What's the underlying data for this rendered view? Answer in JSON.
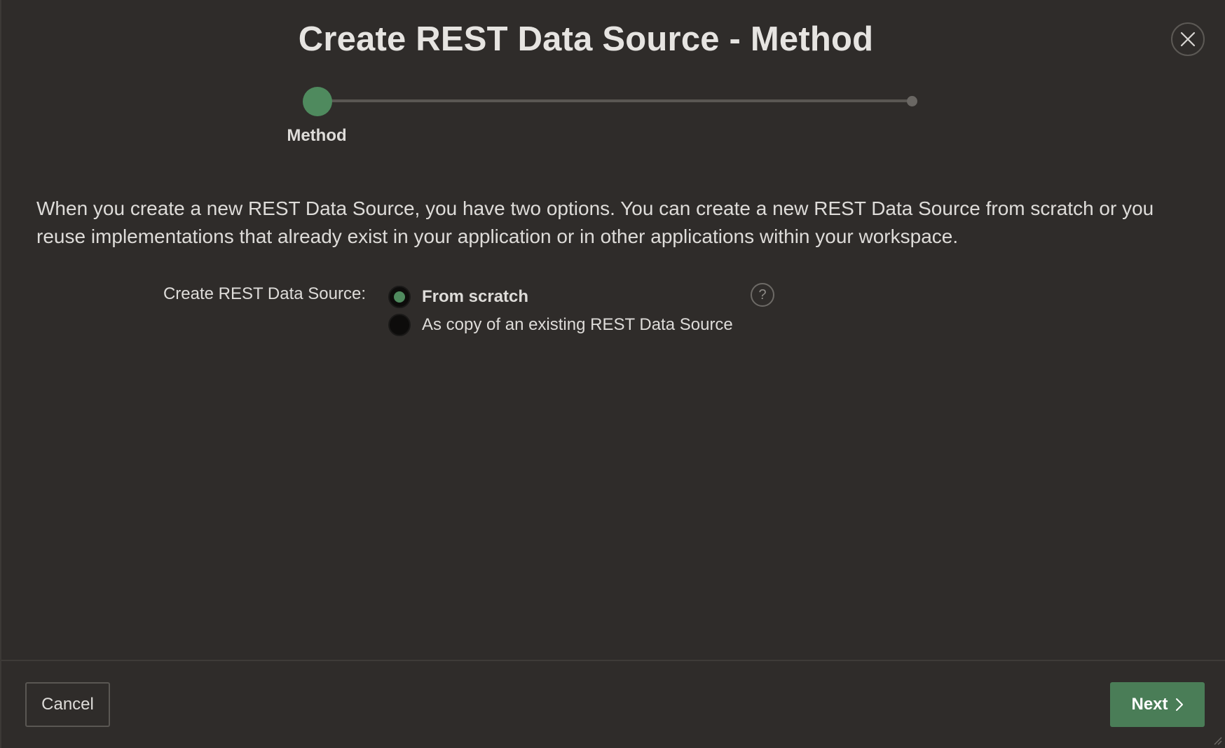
{
  "dialog": {
    "title": "Create REST Data Source - Method",
    "close_icon": "close-icon"
  },
  "wizard": {
    "steps": [
      {
        "label": "Method",
        "state": "active"
      },
      {
        "label": "",
        "state": "pending"
      }
    ]
  },
  "description": "When you create a new REST Data Source, you have two options. You can create a new REST Data Source from scratch or you reuse implementations that already exist in your application or in other applications within your workspace.",
  "form": {
    "field_label": "Create REST Data Source:",
    "options": [
      {
        "label": "From scratch",
        "selected": true
      },
      {
        "label": "As copy of an existing REST Data Source",
        "selected": false
      }
    ],
    "help_glyph": "?"
  },
  "footer": {
    "cancel_label": "Cancel",
    "next_label": "Next",
    "next_icon": "chevron-right-icon"
  },
  "colors": {
    "background": "#2f2c2a",
    "accent_green": "#4f8a5e",
    "next_button": "#4a7d57",
    "track": "#5a5753"
  }
}
